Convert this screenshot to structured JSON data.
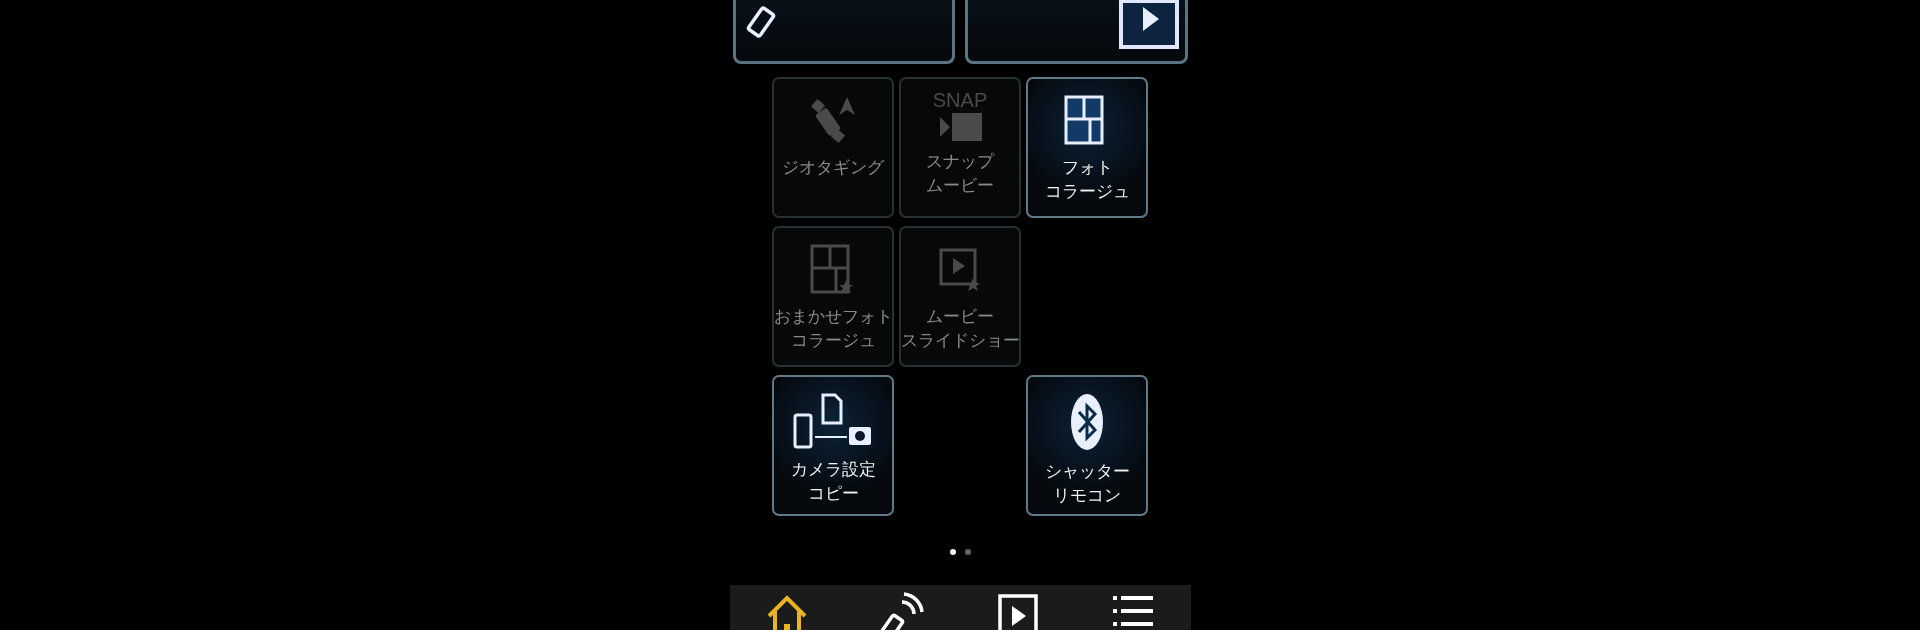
{
  "top_cards": [
    {
      "kind": "remote"
    },
    {
      "kind": "transfer"
    }
  ],
  "tile_rows": [
    [
      {
        "kind": "geotag",
        "lines": [
          "ジオタギング"
        ],
        "enabled": false
      },
      {
        "kind": "snap",
        "icon_text": "SNAP",
        "lines": [
          "スナップ",
          "ムービー"
        ],
        "enabled": false
      },
      {
        "kind": "collage",
        "lines": [
          "フォト",
          "コラージュ"
        ],
        "enabled": true
      }
    ],
    [
      {
        "kind": "auto_collage",
        "lines": [
          "おまかせフォト",
          "コラージュ"
        ],
        "enabled": false
      },
      {
        "kind": "slideshow",
        "lines": [
          "ムービー",
          "スライドショー"
        ],
        "enabled": false
      }
    ],
    [
      {
        "kind": "copy",
        "lines": [
          "カメラ設定",
          "コピー"
        ],
        "enabled": true
      },
      {
        "kind": "empty"
      },
      {
        "kind": "bluetooth",
        "lines": [
          "シャッター",
          "リモコン"
        ],
        "enabled": true
      }
    ]
  ],
  "page_dots": [
    {
      "selected": true
    },
    {
      "selected": false
    }
  ],
  "nav": [
    {
      "kind": "home",
      "selected": true
    },
    {
      "kind": "remote",
      "selected": false
    },
    {
      "kind": "play",
      "selected": false
    },
    {
      "kind": "menu",
      "selected": false
    }
  ]
}
